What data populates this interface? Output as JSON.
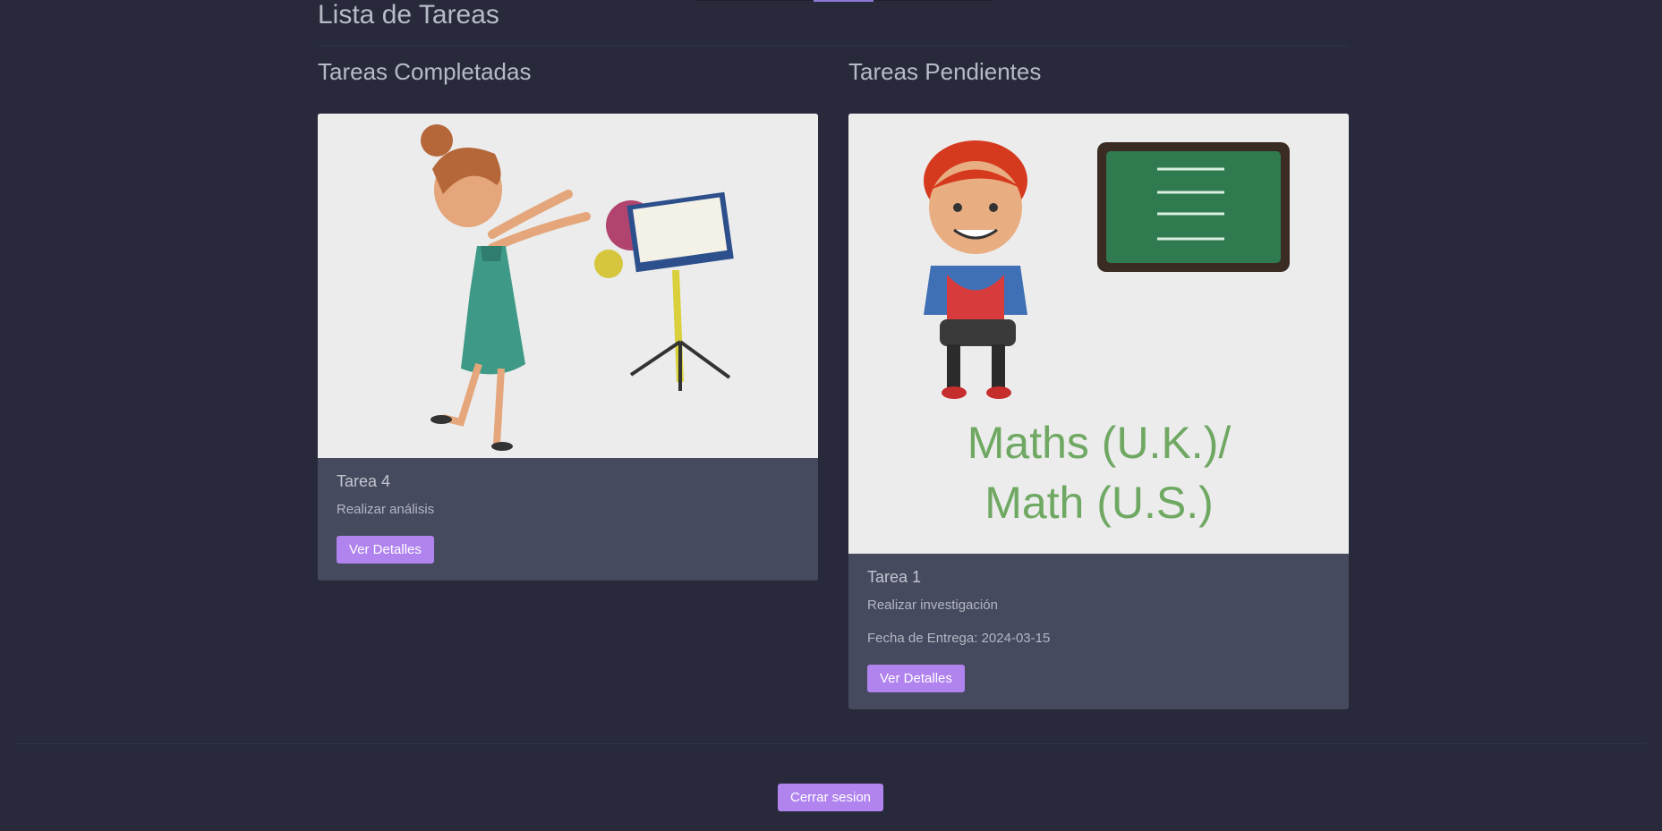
{
  "page": {
    "title": "Lista de Tareas"
  },
  "columns": {
    "completed": {
      "heading": "Tareas Completadas",
      "cards": [
        {
          "title": "Tarea 4",
          "description": "Realizar análisis",
          "button_label": "Ver Detalles",
          "image": "girl-music-cartoon"
        }
      ]
    },
    "pending": {
      "heading": "Tareas Pendientes",
      "cards": [
        {
          "title": "Tarea 1",
          "description": "Realizar investigación",
          "due_date": "Fecha de Entrega: 2024-03-15",
          "button_label": "Ver Detalles",
          "image": "boy-math-chalkboard",
          "image_text_line1": "Maths (U.K.)/",
          "image_text_line2": "Math (U.S.)"
        }
      ]
    }
  },
  "footer": {
    "logout_label": "Cerrar sesion"
  },
  "colors": {
    "background": "#282a3b",
    "card": "#464a5e",
    "accent": "#b083ee"
  }
}
